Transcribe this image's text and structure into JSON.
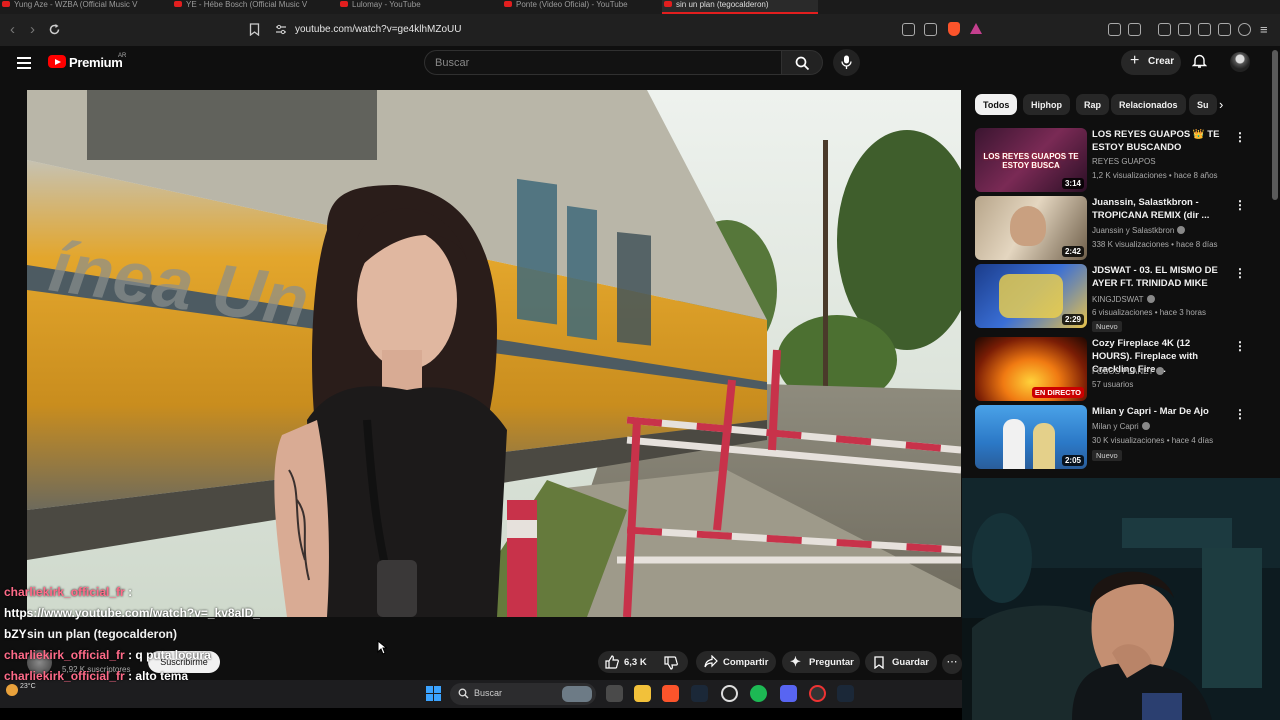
{
  "browser": {
    "tabs": [
      {
        "label": "Yung Aze - WZBA (Official Music V"
      },
      {
        "label": "YE - Hébe Bosch (Official Music V"
      },
      {
        "label": "Lulomay - YouTube"
      },
      {
        "label": "Ponte (Video Oficial) - YouTube"
      },
      {
        "label": "sin un plan (tegocalderon)"
      }
    ],
    "url": "youtube.com/watch?v=ge4klhMZoUU"
  },
  "youtube": {
    "brand": "Premium",
    "country": "AR",
    "search_placeholder": "Buscar",
    "create_label": "Crear"
  },
  "video": {
    "title": "sin un plan (tegocalderon)",
    "subscribers": "5,92 K suscriptores",
    "subscribe_label": "Suscribirme",
    "likes": "6,3 K",
    "share_label": "Compartir",
    "ask_label": "Preguntar",
    "save_label": "Guardar"
  },
  "chat": {
    "messages": [
      {
        "user": "charliekirk_official_fr",
        "text": "https://www.youtube.com/watch?v=_kv8aID_bZY"
      },
      {
        "user": "charliekirk_official_fr",
        "text": "q puta locura"
      },
      {
        "user": "charliekirk_official_fr",
        "text": "alto tema"
      }
    ]
  },
  "sidebar": {
    "chips": [
      "Todos",
      "Hiphop",
      "Rap",
      "Relacionados",
      "Su"
    ],
    "items": [
      {
        "title": "LOS REYES GUAPOS 👑 TE ESTOY BUSCANDO",
        "channel": "REYES GUAPOS",
        "meta": "1,2 K visualizaciones • hace 8 años",
        "duration": "3:14",
        "thumb_text": "LOS REYES GUAPOS TE ESTOY BUSCA",
        "badge": ""
      },
      {
        "title": "Juanssin, Salastkbron - TROPICANA REMIX (dir ...",
        "channel": "Juanssin  y Salastkbron",
        "meta": "338 K visualizaciones • hace 8 días",
        "duration": "2:42",
        "badge": ""
      },
      {
        "title": "JDSWAT - 03. EL MISMO DE AYER FT. TRINIDAD MIKE",
        "channel": "KINGJDSWAT",
        "meta": "6 visualizaciones • hace 3 horas",
        "duration": "2:29",
        "badge": "Nuevo"
      },
      {
        "title": "Cozy Fireplace 4K (12 HOURS). Fireplace with Crackling Fire ...",
        "channel": "FOBOS PLANET",
        "meta": "57 usuarios",
        "duration": "EN DIRECTO",
        "badge": ""
      },
      {
        "title": "Milan y Capri - Mar De Ajo",
        "channel": "Milan y Capri",
        "meta": "30 K visualizaciones • hace 4 días",
        "duration": "2:05",
        "badge": "Nuevo"
      }
    ]
  },
  "taskbar": {
    "weather": "23°C",
    "search_label": "Buscar"
  },
  "colors": {
    "brand_red": "#ff0000",
    "chat_user": "#ff6b89",
    "background": "#0f0f0f"
  }
}
